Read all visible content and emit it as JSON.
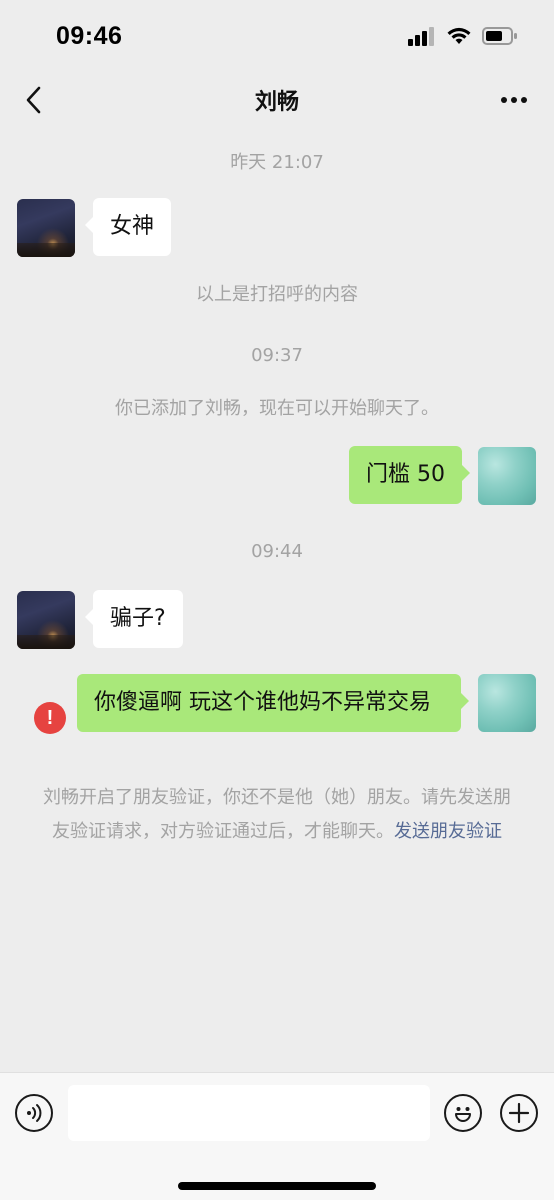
{
  "status_bar": {
    "time": "09:46",
    "icons": [
      "cellular-signal-icon",
      "wifi-icon",
      "battery-icon"
    ]
  },
  "nav": {
    "title": "刘畅",
    "back_icon": "chevron-left-icon",
    "more_icon": "more-dots-icon"
  },
  "messages": {
    "ts1": "昨天 21:07",
    "m1": "女神",
    "greeting_note": "以上是打招呼的内容",
    "ts2": "09:37",
    "added_note": "你已添加了刘畅，现在可以开始聊天了。",
    "m2": "门槛 50",
    "ts3": "09:44",
    "m3": "骗子?",
    "m4": "你傻逼啊 玩这个谁他妈不异常交易",
    "failed_icon": "!",
    "verify_notice": "刘畅开启了朋友验证，你还不是他（她）朋友。请先发送朋友验证请求，对方验证通过后，才能聊天。",
    "verify_link": "发送朋友验证"
  },
  "input_bar": {
    "value": "",
    "voice_icon": "voice-icon",
    "emoji_icon": "emoji-icon",
    "plus_icon": "plus-icon"
  },
  "colors": {
    "background": "#ededed",
    "sent_bubble": "#a9e87a",
    "received_bubble": "#ffffff",
    "system_text": "#a3a3a3",
    "link": "#576b95",
    "error": "#e64340"
  }
}
